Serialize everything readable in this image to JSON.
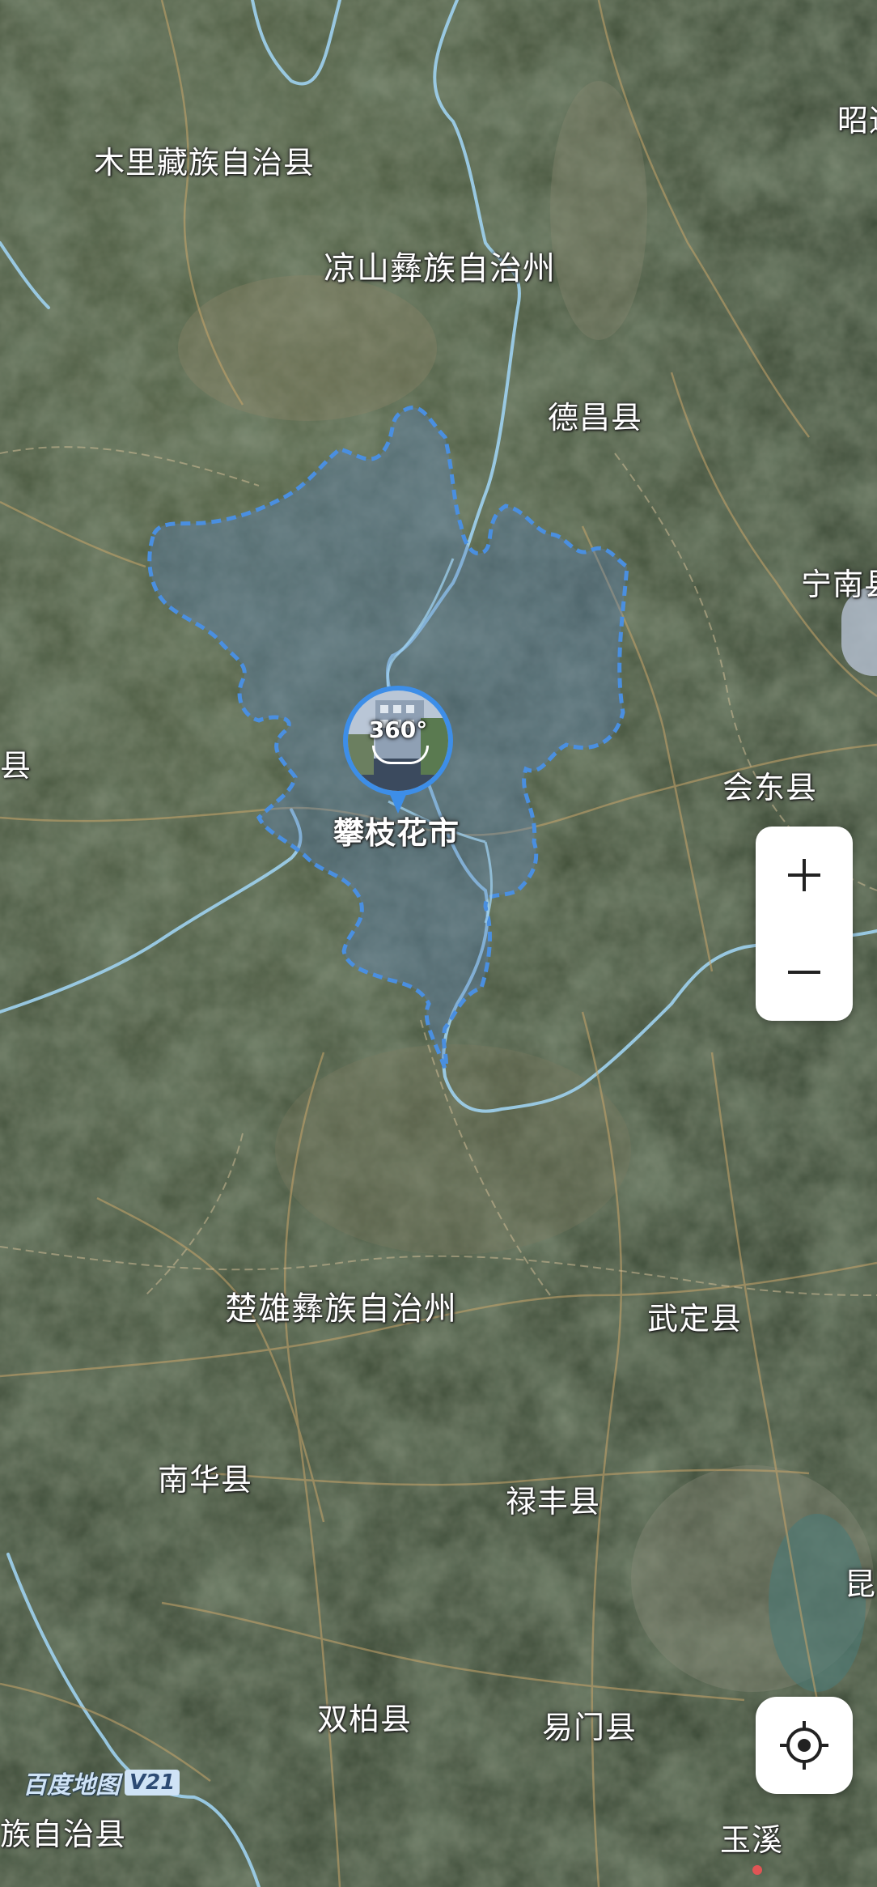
{
  "map": {
    "type": "satellite",
    "region_labels": [
      {
        "id": "muli",
        "text": "木里藏族自治县"
      },
      {
        "id": "liangshan",
        "text": "凉山彝族自治州"
      },
      {
        "id": "zhaotong",
        "text": "昭通"
      },
      {
        "id": "dechang",
        "text": "德昌县"
      },
      {
        "id": "ningnan",
        "text": "宁南县"
      },
      {
        "id": "xian-left",
        "text": "县"
      },
      {
        "id": "huidong",
        "text": "会东县"
      },
      {
        "id": "chuxiong",
        "text": "楚雄彝族自治州"
      },
      {
        "id": "wuding",
        "text": "武定县"
      },
      {
        "id": "nanhua",
        "text": "南华县"
      },
      {
        "id": "lufeng",
        "text": "禄丰县"
      },
      {
        "id": "kunming",
        "text": "昆"
      },
      {
        "id": "shuangbai",
        "text": "双柏县"
      },
      {
        "id": "yimen",
        "text": "易门县"
      },
      {
        "id": "zizhixian",
        "text": "族自治县"
      },
      {
        "id": "yuxi",
        "text": "玉溪"
      }
    ],
    "highlighted_city": "攀枝花市",
    "panorama_badge": "360°",
    "brand": "百度地图",
    "brand_version": "V21"
  },
  "controls": {
    "zoom_in": "+",
    "zoom_out": "−",
    "locate_icon": "locate-icon"
  },
  "colors": {
    "boundary": "#4a8fe0",
    "river": "#9fd1f0",
    "boundary_fill": "rgba(90,130,190,0.35)"
  }
}
